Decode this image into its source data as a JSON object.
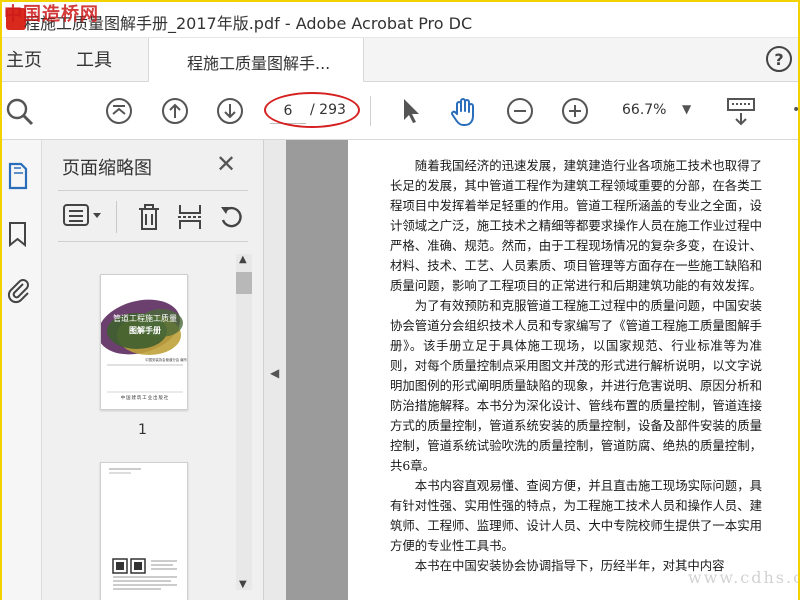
{
  "window": {
    "title": "程施工质量图解手册_2017年版.pdf - Adobe Acrobat Pro DC",
    "watermark": "中国造桥网"
  },
  "tabs": {
    "home": "主页",
    "tools": "工具",
    "document": "程施工质量图解手..."
  },
  "help": {
    "label": "?"
  },
  "toolbar": {
    "current_page": "6",
    "total_pages": "/ 293",
    "zoom": "66.7%"
  },
  "thumbnail_panel": {
    "title": "页面缩略图",
    "close": "✕",
    "page1_label": "1",
    "thumb1": {
      "title_line1": "管道工程施工质量",
      "title_line2": "图解手册",
      "author": "中国安装协会管道分会 编写",
      "publisher": "中国建筑工业出版社"
    }
  },
  "document": {
    "paragraphs": [
      "随着我国经济的迅速发展，建筑建造行业各项施工技术也取得了长足的发展，其中管道工程作为建筑工程领域重要的分部，在各类工程项目中发挥着举足轻重的作用。管道工程所涵盖的专业之全面，设计领域之广泛，施工技术之精细等都要求操作人员在施工作业过程中严格、准确、规范。然而，由于工程现场情况的复杂多变，在设计、材料、技术、工艺、人员素质、项目管理等方面存在一些施工缺陷和质量问题，影响了工程项目的正常进行和后期建筑功能的有效发挥。",
      "为了有效预防和克服管道工程施工过程中的质量问题，中国安装协会管道分会组织技术人员和专家编写了《管道工程施工质量图解手册》。该手册立足于具体施工现场，以国家规范、行业标准等为准则，对每个质量控制点采用图文并茂的形式进行解析说明，以文字说明加图例的形式阐明质量缺陷的现象，并进行危害说明、原因分析和防治措施解释。本书分为深化设计、管线布置的质量控制，管道连接方式的质量控制，管道系统安装的质量控制，设备及部件安装的质量控制，管道系统试验吹洗的质量控制，管道防腐、绝热的质量控制，共6章。",
      "本书内容直观易懂、查阅方便，并且直击施工现场实际问题，具有针对性强、实用性强的特点，为工程施工技术人员和操作人员、建筑师、工程师、监理师、设计人员、大中专院校师生提供了一本实用方便的专业性工具书。",
      "本书在中国安装协会协调指导下，历经半年，对其中内容"
    ],
    "watermark": "www.cdhs.com"
  },
  "colors": {
    "accent_red": "#d62020",
    "border_yellow": "#f2d200",
    "hand_blue": "#2a6ebb"
  }
}
